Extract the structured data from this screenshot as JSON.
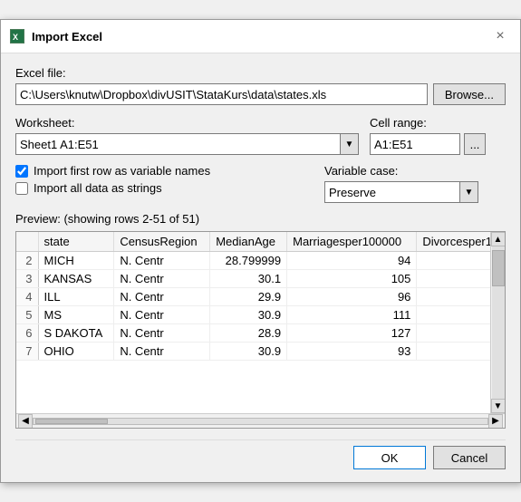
{
  "dialog": {
    "title": "Import Excel",
    "close_label": "×"
  },
  "excel_file": {
    "label": "Excel file:",
    "value": "C:\\Users\\knutw\\Dropbox\\divUSIT\\StataKurs\\data\\states.xls",
    "browse_label": "Browse..."
  },
  "worksheet": {
    "label": "Worksheet:",
    "value": "Sheet1 A1:E51"
  },
  "cell_range": {
    "label": "Cell range:",
    "value": "A1:E51",
    "ellipsis": "..."
  },
  "checkboxes": {
    "import_first_row": {
      "label": "Import first row as variable names",
      "checked": true
    },
    "import_all_strings": {
      "label": "Import all data as strings",
      "checked": false
    }
  },
  "variable_case": {
    "label": "Variable case:",
    "value": "Preserve"
  },
  "preview": {
    "label": "Preview: (showing rows 2-51 of 51)",
    "columns": [
      "",
      "state",
      "CensusRegion",
      "MedianAge",
      "Marriagesper100000",
      "Divorcesper1"
    ],
    "rows": [
      [
        "2",
        "MICH",
        "N. Centr",
        "28.799999",
        "94",
        ""
      ],
      [
        "3",
        "KANSAS",
        "N. Centr",
        "30.1",
        "105",
        ""
      ],
      [
        "4",
        "ILL",
        "N. Centr",
        "29.9",
        "96",
        ""
      ],
      [
        "5",
        "MS",
        "N. Centr",
        "30.9",
        "111",
        ""
      ],
      [
        "6",
        "S DAKOTA",
        "N. Centr",
        "28.9",
        "127",
        ""
      ],
      [
        "7",
        "OHIO",
        "N. Centr",
        "30.9",
        "93",
        ""
      ]
    ]
  },
  "buttons": {
    "ok": "OK",
    "cancel": "Cancel"
  }
}
